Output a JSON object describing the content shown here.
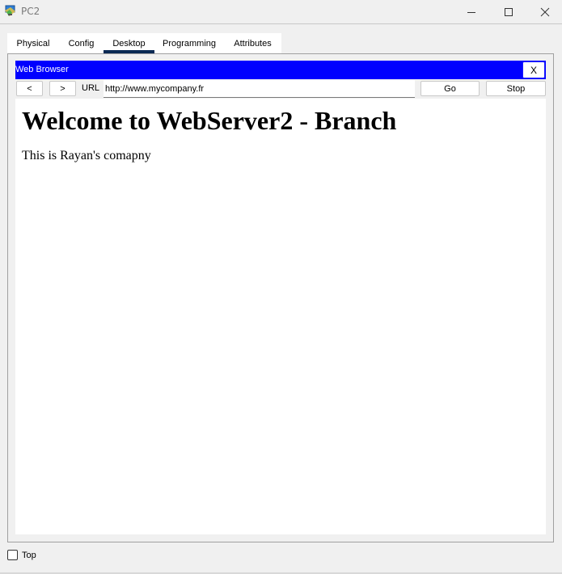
{
  "window": {
    "title": "PC2",
    "icon": "packet-tracer-pc-icon",
    "controls": [
      "minimize-icon",
      "maximize-icon",
      "close-icon"
    ]
  },
  "tabs": [
    {
      "label": "Physical"
    },
    {
      "label": "Config"
    },
    {
      "label": "Desktop",
      "active": true
    },
    {
      "label": "Programming"
    },
    {
      "label": "Attributes"
    }
  ],
  "browser": {
    "title": "Web Browser",
    "close_label": "X",
    "back_label": "<",
    "forward_label": ">",
    "url_label": "URL",
    "url_value": "http://www.mycompany.fr",
    "go_label": "Go",
    "stop_label": "Stop",
    "titlebar_color": "#0000ff"
  },
  "page": {
    "heading": "Welcome to WebServer2 - Branch",
    "body": "This is Rayan's comapny"
  },
  "footer": {
    "top_label": "Top",
    "top_checked": false
  },
  "colors": {
    "active_tab_indicator": "#0b2a54"
  }
}
